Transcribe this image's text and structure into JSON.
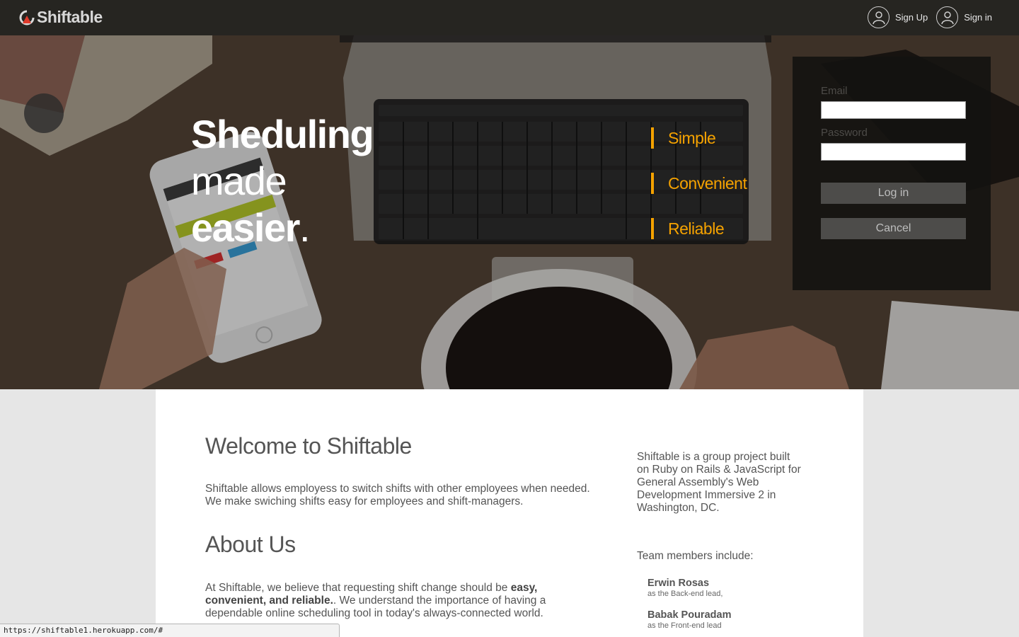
{
  "nav": {
    "brand": "Shiftable",
    "signup_label": "Sign Up",
    "signin_label": "Sign in"
  },
  "hero": {
    "line1": "Sheduling",
    "line2": "made",
    "line3": "easier",
    "line3_dot": ".",
    "features": [
      "Simple",
      "Convenient",
      "Reliable"
    ]
  },
  "login": {
    "email_label": "Email",
    "email_value": "",
    "password_label": "Password",
    "password_value": "",
    "login_button": "Log in",
    "cancel_button": "Cancel"
  },
  "content": {
    "welcome_title": "Welcome to Shiftable",
    "welcome_line1": "Shiftable allows employess to switch shifts with other employees when needed.",
    "welcome_line2": "We make swiching shifts easy for employees and shift-managers.",
    "about_title": "About Us",
    "about_pre": "At Shiftable, we believe that requesting shift change should be ",
    "about_bold1": "easy,",
    "about_bold2": "convenient, and reliable.",
    "about_post1": ". We understand the importance of having a",
    "about_post2": "dependable online scheduling tool in today's always-connected world.",
    "project_lines": [
      "Shiftable is a group project built",
      "on Ruby on Rails & JavaScript for",
      "General Assembly's Web",
      "Development Immersive 2 in",
      "Washington, DC."
    ],
    "team_heading": "Team members include:",
    "members": [
      {
        "name": "Erwin Rosas",
        "role": "as the Back-end lead,"
      },
      {
        "name": "Babak Pouradam",
        "role": "as the Front-end lead"
      }
    ]
  },
  "statusbar": {
    "url": "https://shiftable1.herokuapp.com/#"
  },
  "colors": {
    "accent": "#f5a200",
    "navbar": "#262521",
    "login_panel": "#141210"
  }
}
